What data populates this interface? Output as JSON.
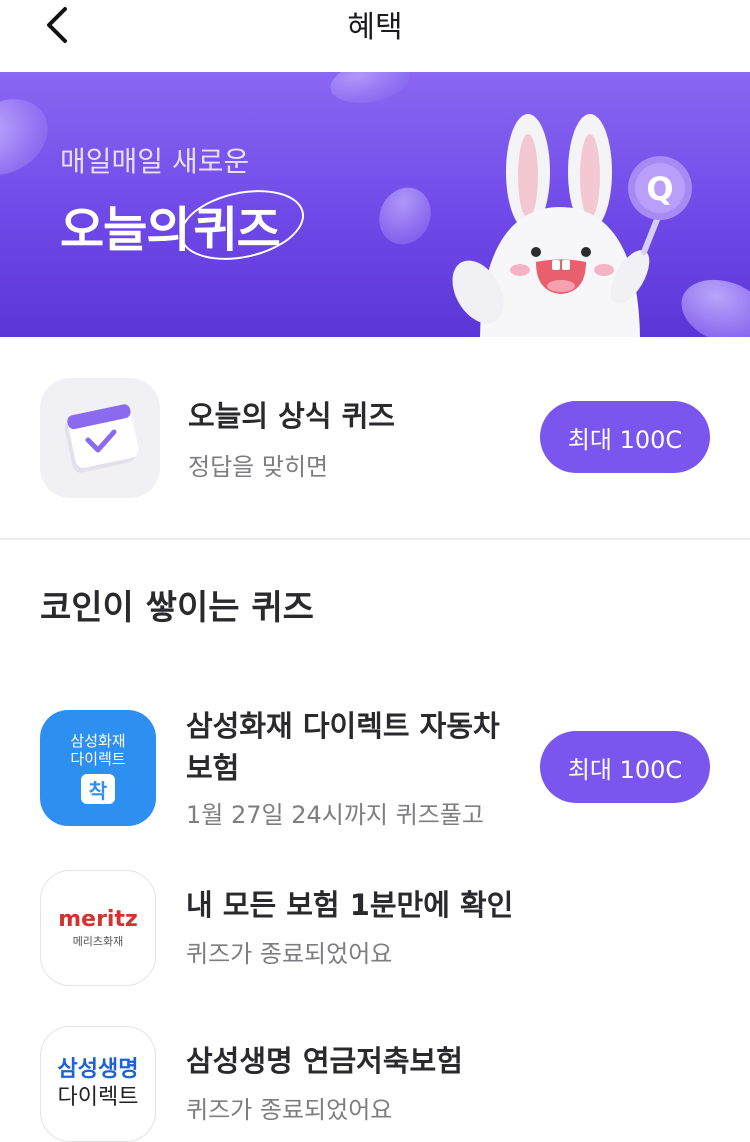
{
  "header": {
    "title": "혜택"
  },
  "banner": {
    "subtitle": "매일매일 새로운",
    "title_prefix": "오늘의",
    "title_highlight": "퀴즈",
    "badge_letter": "Q"
  },
  "daily_quiz": {
    "title": "오늘의 상식 퀴즈",
    "subtitle": "정답을 맞히면",
    "reward": "최대 100C"
  },
  "section": {
    "title": "코인이 쌓이는 퀴즈"
  },
  "quizzes": [
    {
      "title_line1": "삼성화재 다이렉트 자동차",
      "title_line2": "보험",
      "subtitle": "1월 27일 24시까지 퀴즈풀고",
      "reward": "최대 100C",
      "logo_line1": "삼성화재",
      "logo_line2": "다이렉트",
      "logo_mark": "착"
    },
    {
      "title": "내 모든 보험 1분만에 확인",
      "subtitle": "퀴즈가 종료되었어요",
      "logo_word": "meritz",
      "logo_sub": "메리츠화재"
    },
    {
      "title": "삼성생명 연금저축보험",
      "subtitle": "퀴즈가 종료되었어요",
      "logo_line1": "삼성생명",
      "logo_line2": "다이렉트"
    }
  ],
  "colors": {
    "accent": "#7a56ee",
    "banner_top": "#8a67f2",
    "banner_bottom": "#5a36d6",
    "samsung_blue": "#2d8ff0"
  }
}
